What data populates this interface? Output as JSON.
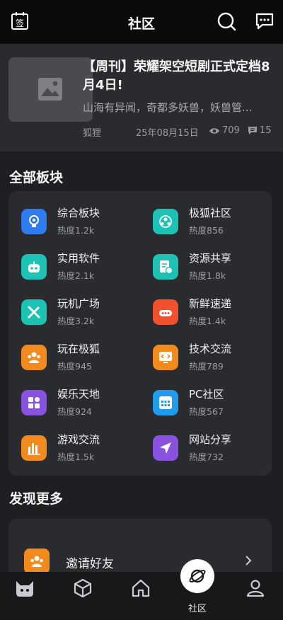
{
  "header": {
    "title": "社区",
    "signin_icon_glyph": "签"
  },
  "featured": {
    "title": "【周刊】荣耀架空短剧正式定档8月4日!",
    "excerpt": "山海有异闻，奇都多妖兽，妖兽管...",
    "author": "狐狸",
    "date": "25年08月15日",
    "views": "709",
    "comments": "15"
  },
  "sections": {
    "all_boards": "全部板块",
    "discover_more": "发现更多"
  },
  "boards": [
    {
      "name": "综合板块",
      "heat": "热度1.2k",
      "color": "#2f7bf0",
      "icon": "lightbulb-icon"
    },
    {
      "name": "极狐社区",
      "heat": "热度856",
      "color": "#1cc2b4",
      "icon": "community-icon"
    },
    {
      "name": "实用软件",
      "heat": "热度2.1k",
      "color": "#1cc2b4",
      "icon": "robot-icon"
    },
    {
      "name": "资源共享",
      "heat": "热度1.8k",
      "color": "#1cc2b4",
      "icon": "document-share-icon"
    },
    {
      "name": "玩机广场",
      "heat": "热度3.2k",
      "color": "#1cc2b4",
      "icon": "tools-icon"
    },
    {
      "name": "新鲜速递",
      "heat": "热度1.4k",
      "color": "#f0522e",
      "icon": "delivery-icon"
    },
    {
      "name": "玩在极狐",
      "heat": "热度945",
      "color": "#f28a1e",
      "icon": "people-icon"
    },
    {
      "name": "技术交流",
      "heat": "热度789",
      "color": "#f28a1e",
      "icon": "code-monitor-icon"
    },
    {
      "name": "娱乐天地",
      "heat": "热度924",
      "color": "#8a52e0",
      "icon": "grid-icon"
    },
    {
      "name": "PC社区",
      "heat": "热度567",
      "color": "#1f9bf0",
      "icon": "keypad-icon"
    },
    {
      "name": "游戏交流",
      "heat": "热度1.5k",
      "color": "#f28a1e",
      "icon": "bar-chart-icon"
    },
    {
      "name": "网站分享",
      "heat": "热度732",
      "color": "#8a52e0",
      "icon": "send-arrow-icon"
    }
  ],
  "discover": {
    "invite_label": "邀请好友"
  },
  "nav": {
    "active_label": "社区"
  }
}
